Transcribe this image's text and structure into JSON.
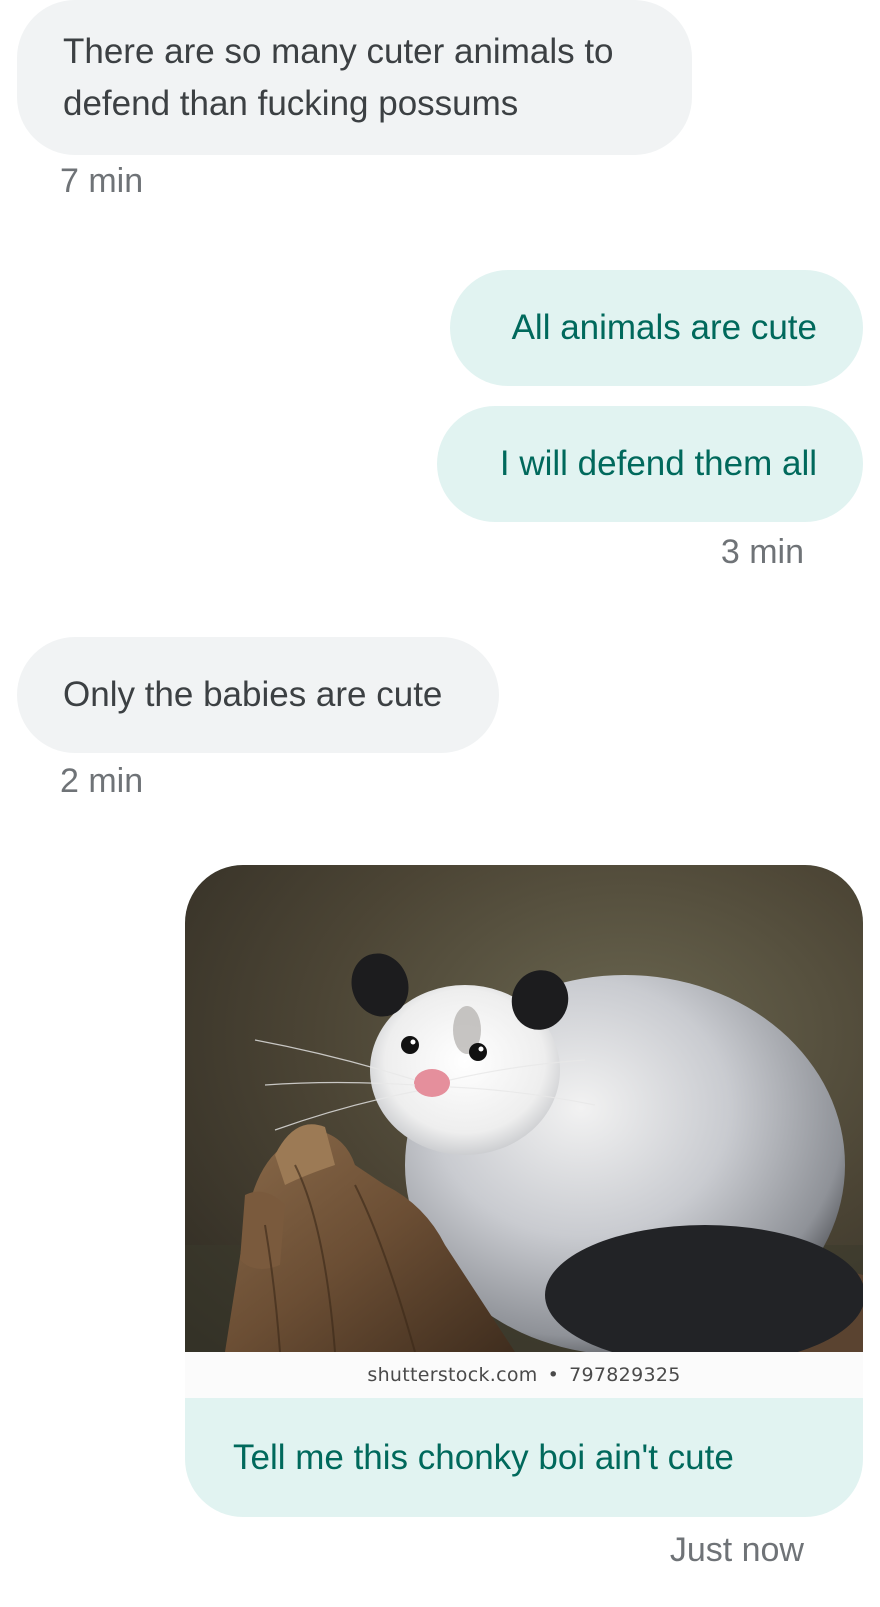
{
  "messages": [
    {
      "id": "m1",
      "direction": "incoming",
      "text": "There are so many cuter animals to defend than fucking possums"
    },
    {
      "id": "m2",
      "direction": "outgoing",
      "text": "All animals are cute"
    },
    {
      "id": "m3",
      "direction": "outgoing",
      "text": "I will defend them all"
    },
    {
      "id": "m4",
      "direction": "incoming",
      "text": "Only the babies are cute"
    },
    {
      "id": "m5",
      "direction": "outgoing",
      "type": "image",
      "image_subject": "opossum-photo",
      "text": "Tell me this chonky boi ain't cute"
    }
  ],
  "timestamps": {
    "t1": "7 min",
    "t2": "3 min",
    "t3": "2 min",
    "t4": "Just now"
  },
  "watermark": {
    "site": "shutterstock.com",
    "separator": "•",
    "id": "797829325"
  },
  "colors": {
    "incoming_bg": "#f1f3f4",
    "incoming_text": "#3c4043",
    "outgoing_bg": "#e1f3f1",
    "outgoing_text": "#00695c",
    "timestamp": "#6f7377"
  }
}
